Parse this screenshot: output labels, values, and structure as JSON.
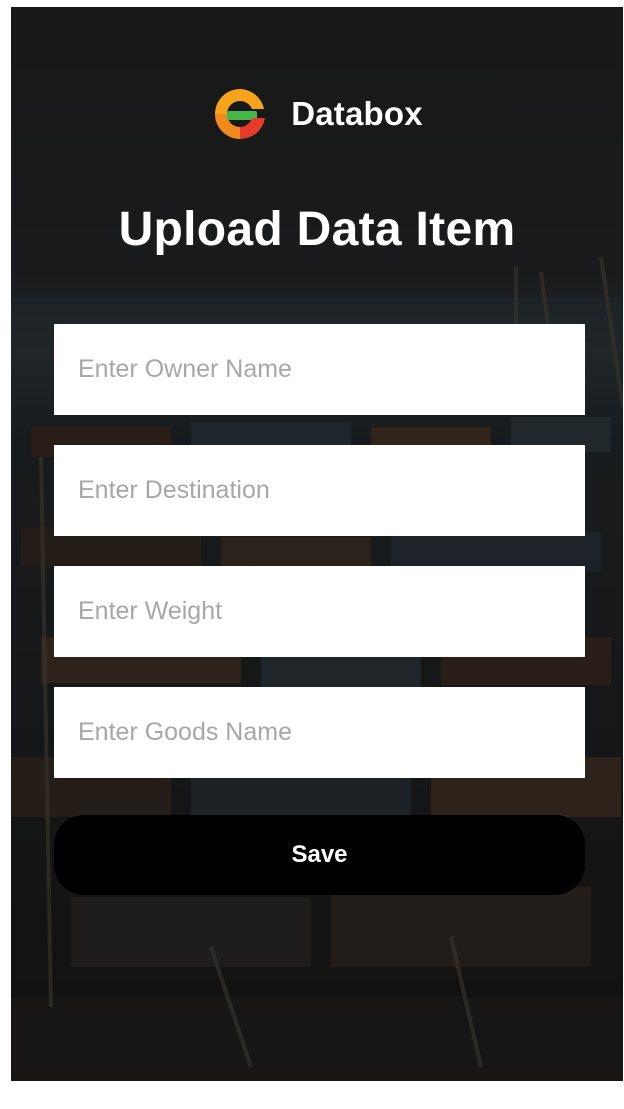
{
  "brand": {
    "name": "Databox",
    "logo_icon": "databox-logo-icon"
  },
  "page": {
    "title": "Upload Data Item"
  },
  "form": {
    "owner_placeholder": "Enter Owner Name",
    "destination_placeholder": "Enter Destination",
    "weight_placeholder": "Enter Weight",
    "goods_placeholder": "Enter Goods Name",
    "save_label": "Save"
  },
  "colors": {
    "button_bg": "#000000",
    "field_bg": "#ffffff",
    "placeholder": "#a7a7a7",
    "logo_orange": "#f7a21b",
    "logo_green": "#46b649",
    "logo_red": "#e43b2d"
  }
}
